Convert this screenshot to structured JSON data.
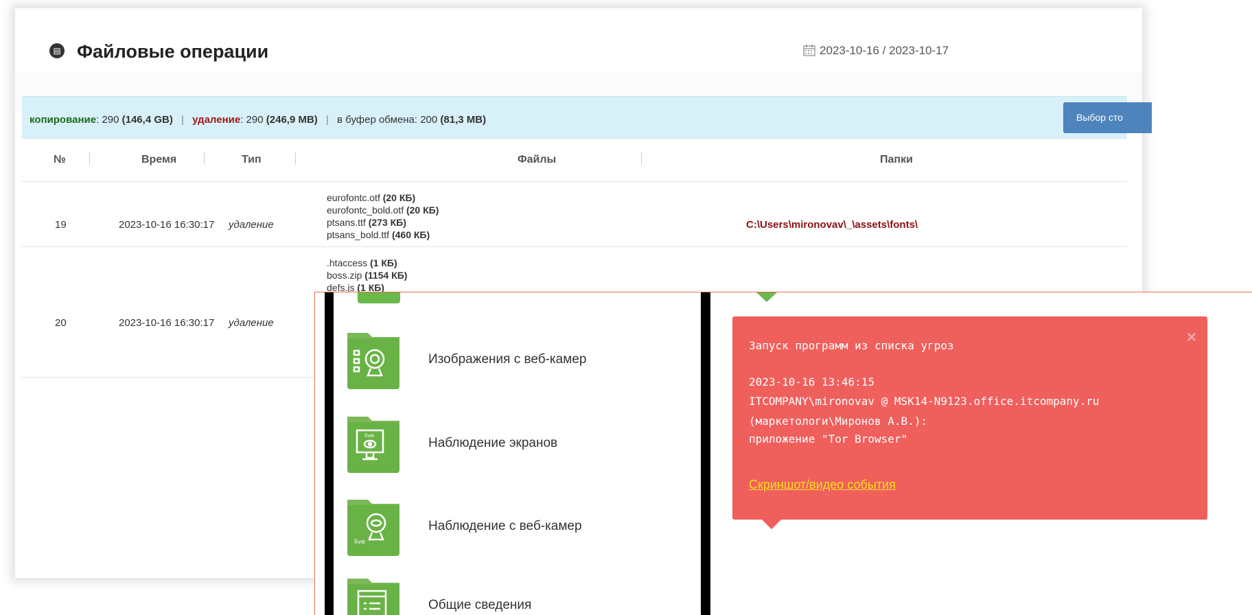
{
  "file_ops": {
    "title": "Файловые операции",
    "date_range": "2023-10-16 / 2023-10-17",
    "stats": {
      "copy_label": "копирование",
      "copy_count": ": 290",
      "copy_size": "(146,4 GB)",
      "delete_label": "удаление",
      "delete_count": ": 290",
      "delete_size": "(246,9 MB)",
      "clipboard_label": "в буфер обмена",
      "clipboard_count": ": 200",
      "clipboard_size": "(81,3 MB)",
      "separator": "|"
    },
    "columns_button": "Выбор сто",
    "columns": [
      "№",
      "Время",
      "Тип",
      "Файлы",
      "Папки"
    ],
    "rows": [
      {
        "num": "19",
        "time": "2023-10-16 16:30:17",
        "type": "удаление",
        "files": [
          {
            "name": "eurofontc.otf",
            "size": "(20 КБ)"
          },
          {
            "name": "eurofontc_bold.otf",
            "size": "(20 КБ)"
          },
          {
            "name": "ptsans.ttf",
            "size": "(273 КБ)"
          },
          {
            "name": "ptsans_bold.ttf",
            "size": "(460 КБ)"
          }
        ],
        "folder": "C:\\Users\\mironovav\\_\\assets\\fonts\\"
      },
      {
        "num": "20",
        "time": "2023-10-16 16:30:17",
        "type": "удаление",
        "files": [
          {
            "name": ".htaccess",
            "size": "(1 КБ)"
          },
          {
            "name": "boss.zip",
            "size": "(1154 КБ)"
          },
          {
            "name": "defs.js",
            "size": "(1 КБ)"
          }
        ],
        "folder": ""
      }
    ]
  },
  "menu": {
    "items": [
      {
        "label": "Изображения с веб-камер",
        "icon": "webcam-images-icon"
      },
      {
        "label": "Наблюдение экранов",
        "icon": "live-screen-icon"
      },
      {
        "label": "Наблюдение с веб-камер",
        "icon": "live-webcam-icon"
      },
      {
        "label": "Общие сведения",
        "icon": "general-info-icon"
      }
    ]
  },
  "alert": {
    "title": "Запуск программ из списка угроз",
    "timestamp": "2023-10-16 13:46:15",
    "user_line": "ITCOMPANY\\mironovav @ MSK14-N9123.office.itcompany.ru",
    "group_line": "(маркетологи\\Миронов А.В.):",
    "app_line": "приложение \"Tor Browser\"",
    "link": "Скриншот/видео события",
    "close": "×"
  },
  "colors": {
    "accent_blue": "#4e84bd",
    "alert_red": "#ef5f5c",
    "tile_green": "#6bb84a",
    "copy_green": "#1b6b1b",
    "delete_red": "#a01818",
    "link_yellow": "#f8e11c"
  }
}
